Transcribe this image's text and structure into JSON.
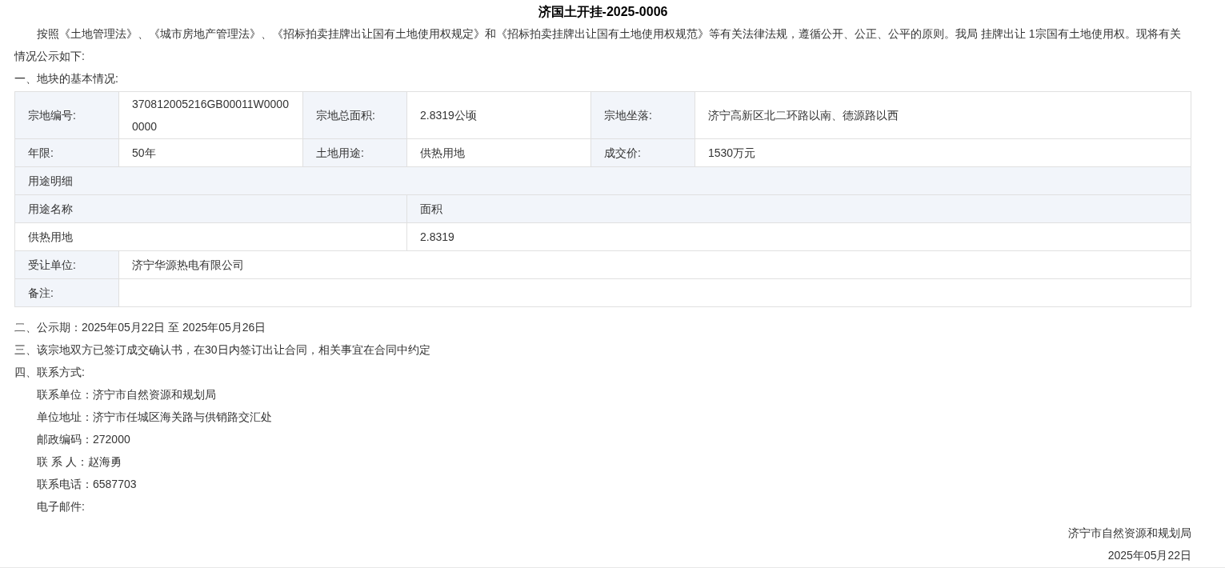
{
  "title": "济国土开挂-2025-0006",
  "intro": "按照《土地管理法》、《城市房地产管理法》、《招标拍卖挂牌出让国有土地使用权规定》和《招标拍卖挂牌出让国有土地使用权规范》等有关法律法规，遵循公开、公正、公平的原则。我局 挂牌出让 1宗国有土地使用权。现将有关情况公示如下:",
  "section_1": "一、地块的基本情况:",
  "parcel_table": {
    "basic_rows": [
      [
        {
          "label": "宗地编号:",
          "value": "370812005216GB00011W00000000"
        },
        {
          "label": "宗地总面积:",
          "value": "2.8319公顷"
        },
        {
          "label": "宗地坐落:",
          "value": "济宁高新区北二环路以南、德源路以西"
        }
      ],
      [
        {
          "label": "年限:",
          "value": "50年"
        },
        {
          "label": "土地用途:",
          "value": "供热用地"
        },
        {
          "label": "成交价:",
          "value": "1530万元"
        }
      ]
    ],
    "usage_detail": {
      "title": "用途明细",
      "columns": [
        "用途名称",
        "面积"
      ],
      "rows": [
        [
          "供热用地",
          "2.8319"
        ]
      ]
    },
    "transferee": {
      "label": "受让单位:",
      "value": "济宁华源热电有限公司"
    },
    "remarks": {
      "label": "备注:"
    }
  },
  "section_2": "二、公示期：2025年05月22日 至 2025年05月26日",
  "section_3": "三、该宗地双方已签订成交确认书，在30日内签订出让合同，相关事宜在合同中约定",
  "section_4": "四、联系方式:",
  "contacts": [
    "联系单位：济宁市自然资源和规划局",
    "单位地址：济宁市任城区海关路与供销路交汇处",
    "邮政编码：272000",
    "联 系 人：赵海勇",
    "联系电话：6587703",
    "电子邮件:"
  ],
  "signature": {
    "issuer": "济宁市自然资源和规划局",
    "date": "2025年05月22日"
  }
}
